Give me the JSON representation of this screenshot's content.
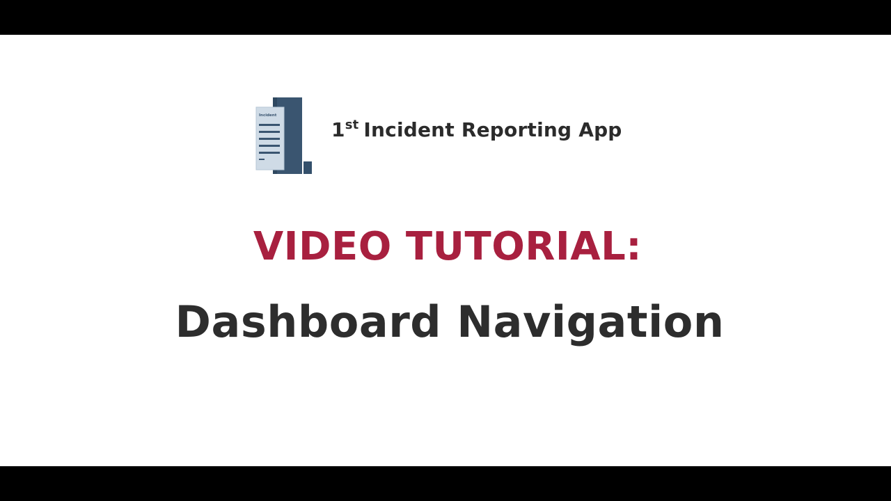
{
  "app": {
    "name_number": "1",
    "name_superscript": "st",
    "name_rest": "Incident Reporting App",
    "logo_icon": "document-report-icon",
    "logo_mini_text": "Incident"
  },
  "slide": {
    "headline": "VIDEO TUTORIAL:",
    "subheadline": "Dashboard Navigation"
  },
  "colors": {
    "headline": "#a8203f",
    "text": "#2d2d2d",
    "logo_dark": "#3a5570",
    "logo_light": "#cfdbe6",
    "background": "#ffffff",
    "letterbox": "#000000"
  }
}
